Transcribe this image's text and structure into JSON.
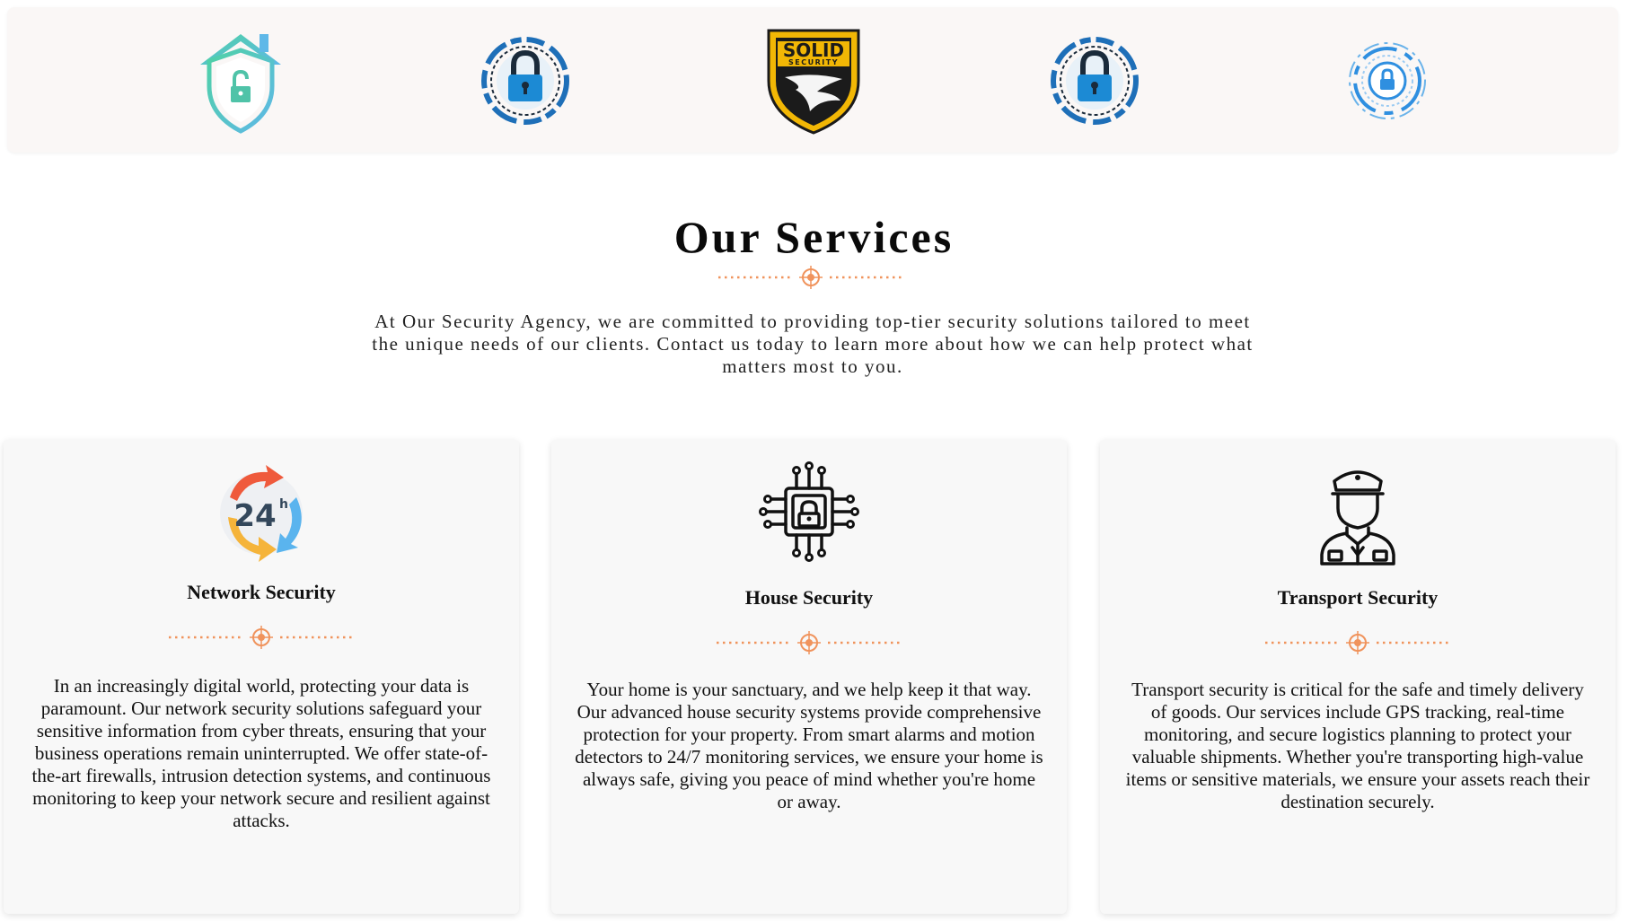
{
  "logos": [
    {
      "name": "house-shield-lock-logo"
    },
    {
      "name": "circular-padlock-logo"
    },
    {
      "name": "solid-security-logo",
      "text_line1": "SOLID",
      "text_line2": "SECURITY"
    },
    {
      "name": "circular-padlock-logo"
    },
    {
      "name": "fingerprint-lock-logo"
    }
  ],
  "section": {
    "title": "Our Services",
    "intro": "At Our Security Agency, we are committed to providing top-tier security solutions tailored to meet the unique needs of our clients. Contact us today to learn more about how we can help protect what matters most to you."
  },
  "services": [
    {
      "icon": "24h-icon",
      "icon_text": "24",
      "icon_sup": "h",
      "title": "Network Security",
      "text": "In an increasingly digital world, protecting your data is paramount. Our network security solutions safeguard your sensitive information from cyber threats, ensuring that your business operations remain uninterrupted. We offer state-of-the-art firewalls, intrusion detection systems, and continuous monitoring to keep your network secure and resilient against attacks."
    },
    {
      "icon": "circuit-lock-icon",
      "title": "House Security",
      "text": "Your home is your sanctuary, and we help keep it that way. Our advanced house security systems provide comprehensive protection for your property. From smart alarms and motion detectors to 24/7 monitoring services, we ensure your home is always safe, giving you peace of mind whether you're home or away."
    },
    {
      "icon": "security-guard-icon",
      "title": "Transport Security",
      "text": "Transport security is critical for the safe and timely delivery of goods. Our services include GPS tracking, real-time monitoring, and secure logistics planning to protect your valuable shipments. Whether you're transporting high-value items or sensitive materials, we ensure your assets reach their destination securely."
    }
  ],
  "colors": {
    "accent": "#f0935c",
    "strip_background": "#faf7f6",
    "card_background": "#f8f8f8"
  }
}
